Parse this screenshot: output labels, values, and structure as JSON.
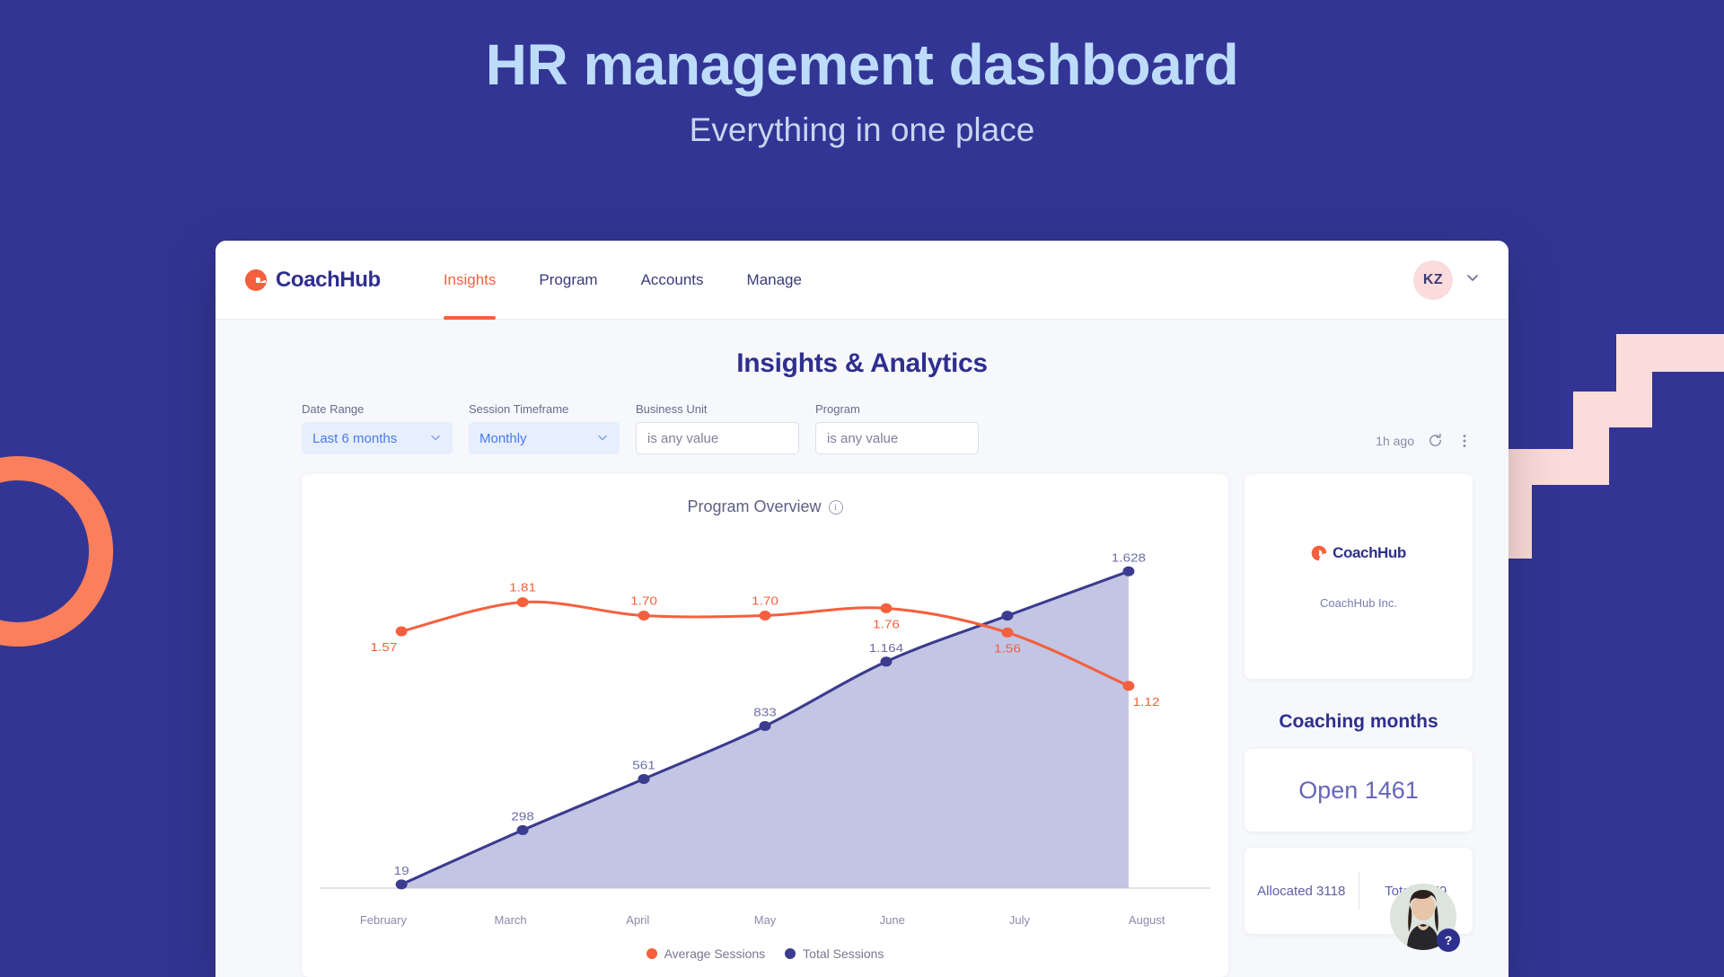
{
  "hero": {
    "title": "HR management dashboard",
    "subtitle": "Everything in one place"
  },
  "colors": {
    "background": "#333594",
    "brand_orange": "#F4603E",
    "brand_navy": "#2F2F8F",
    "accent_pink": "#FCDCDA",
    "hero_title": "#BDDCFA"
  },
  "navbar": {
    "brand_name": "CoachHub",
    "brand_mark_icon": "coachhub-logo-icon",
    "links": [
      {
        "label": "Insights",
        "active": true
      },
      {
        "label": "Program",
        "active": false
      },
      {
        "label": "Accounts",
        "active": false
      },
      {
        "label": "Manage",
        "active": false
      }
    ],
    "avatar_initials": "KZ",
    "chevron_icon": "chevron-down-icon"
  },
  "page": {
    "title": "Insights & Analytics"
  },
  "filters": [
    {
      "label": "Date Range",
      "value": "Last 6 months",
      "type": "select",
      "state": "selected"
    },
    {
      "label": "Session Timeframe",
      "value": "Monthly",
      "type": "select",
      "state": "selected"
    },
    {
      "label": "Business Unit",
      "value": "is any value",
      "type": "text",
      "state": "empty"
    },
    {
      "label": "Program",
      "value": "is any value",
      "type": "text",
      "state": "empty"
    }
  ],
  "toolbar": {
    "last_refresh": "1h ago",
    "refresh_icon": "refresh-icon",
    "more_icon": "more-vertical-icon"
  },
  "chart_card": {
    "title": "Program Overview",
    "info_icon": "info-icon"
  },
  "chart_data": {
    "type": "line",
    "title": "Program Overview",
    "xlabel": "",
    "ylabel": "",
    "grid": false,
    "legend_position": "bottom",
    "categories": [
      "February",
      "March",
      "April",
      "May",
      "June",
      "July",
      "August"
    ],
    "series": [
      {
        "name": "Average Sessions",
        "color": "#F4603E",
        "values": [
          1.57,
          1.81,
          1.7,
          1.7,
          1.76,
          1.56,
          1.12
        ],
        "labels": [
          "1.57",
          "1.81",
          "1.70",
          "1.70",
          "1.76",
          "1.56",
          "1.12"
        ],
        "ylim": [
          0,
          2.0
        ]
      },
      {
        "name": "Total Sessions",
        "color": "#3B3B8F",
        "values": [
          19,
          298,
          561,
          833,
          1164,
          1400,
          1628
        ],
        "labels": [
          "19",
          "298",
          "561",
          "833",
          "1.164",
          "",
          "1.628"
        ],
        "area_fill": "#B9BBE0",
        "ylim": [
          0,
          1800
        ]
      }
    ]
  },
  "side": {
    "brand_card": {
      "logo_name": "CoachHub",
      "company": "CoachHub Inc."
    },
    "heading": "Coaching months",
    "open_label": "Open 1461",
    "allocated_label": "Allocated 3118",
    "total_label": "Total 4579"
  },
  "help_widget": {
    "badge": "?",
    "avatar_icon": "support-agent-avatar"
  }
}
